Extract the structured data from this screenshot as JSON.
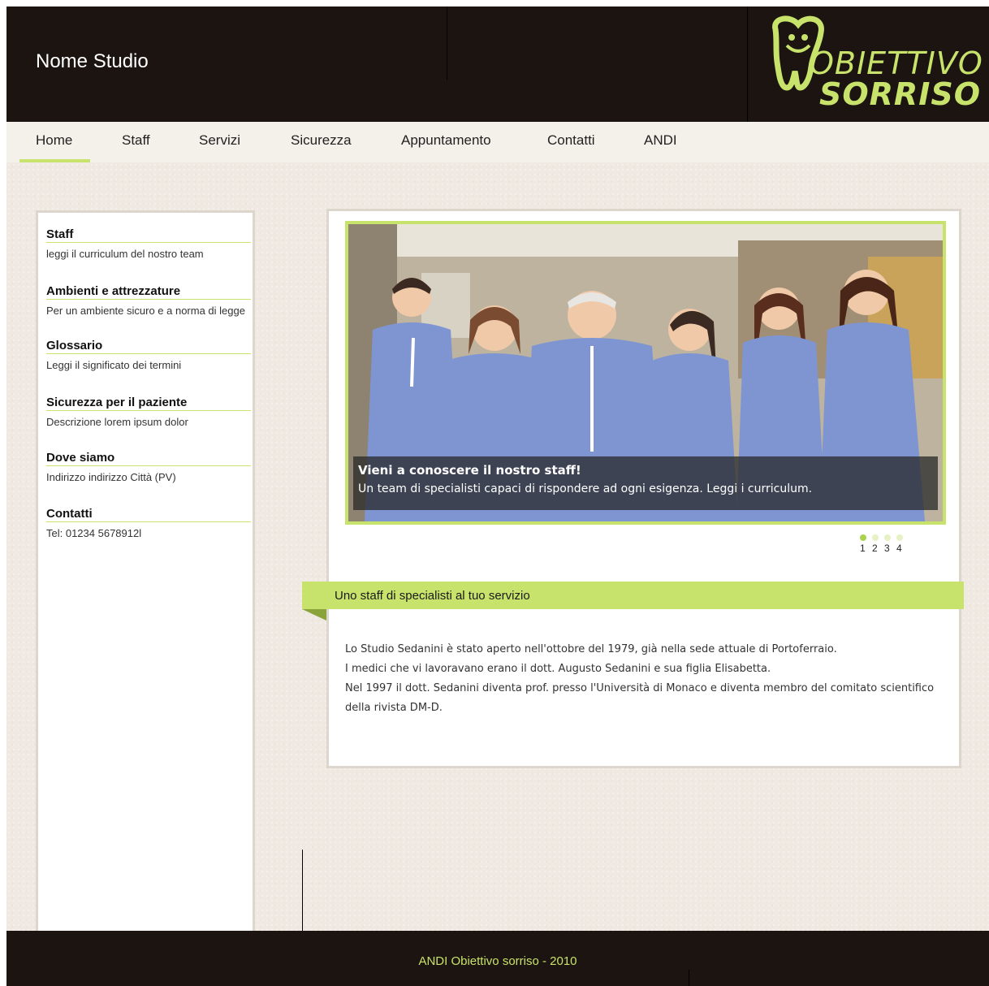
{
  "header": {
    "site_name": "Nome Studio",
    "logo": {
      "line1": "OBIETTIVO",
      "line2": "SORRISO"
    }
  },
  "nav": {
    "items": [
      {
        "label": "Home",
        "active": true
      },
      {
        "label": "Staff"
      },
      {
        "label": "Servizi"
      },
      {
        "label": "Sicurezza"
      },
      {
        "label": "Appuntamento"
      },
      {
        "label": "Contatti"
      },
      {
        "label": "ANDI"
      }
    ]
  },
  "sidebar": {
    "items": [
      {
        "title": "Staff",
        "desc": "leggi il curriculum del nostro team"
      },
      {
        "title": "Ambienti e attrezzature",
        "desc": "Per un ambiente sicuro e a norma di legge"
      },
      {
        "title": "Glossario",
        "desc": "Leggi il significato dei termini"
      },
      {
        "title": "Sicurezza per il paziente",
        "desc": "Descrizione lorem ipsum dolor"
      },
      {
        "title": "Dove siamo",
        "desc": "Indirizzo indirizzo Città (PV)"
      },
      {
        "title": "Contatti",
        "desc": "Tel: 01234 5678912l"
      }
    ]
  },
  "slider": {
    "caption_title": "Vieni a conoscere il nostro  staff!",
    "caption_text": "Un team di specialisti capaci di rispondere ad ogni esigenza. Leggi i curriculum.",
    "pages": [
      "1",
      "2",
      "3",
      "4"
    ],
    "active_page": 1
  },
  "content": {
    "ribbon_title": "Uno staff di specialisti al tuo servizio",
    "paragraphs": [
      "Lo Studio Sedanini è stato aperto nell'ottobre del 1979, già nella sede attuale di Portoferraio.",
      "I medici che vi lavoravano erano il dott. Augusto Sedanini e sua figlia Elisabetta.",
      "Nel 1997 il dott. Sedanini diventa prof. presso l'Università di Monaco e diventa membro del comitato scientifico della rivista DM-D."
    ]
  },
  "footer": {
    "text": "ANDI Obiettivo sorriso - 2010"
  },
  "colors": {
    "accent": "#c8e36b",
    "header_bg": "#1c1410",
    "page_bg": "#efe9e2",
    "scrub_blue": "#7f95d2"
  }
}
